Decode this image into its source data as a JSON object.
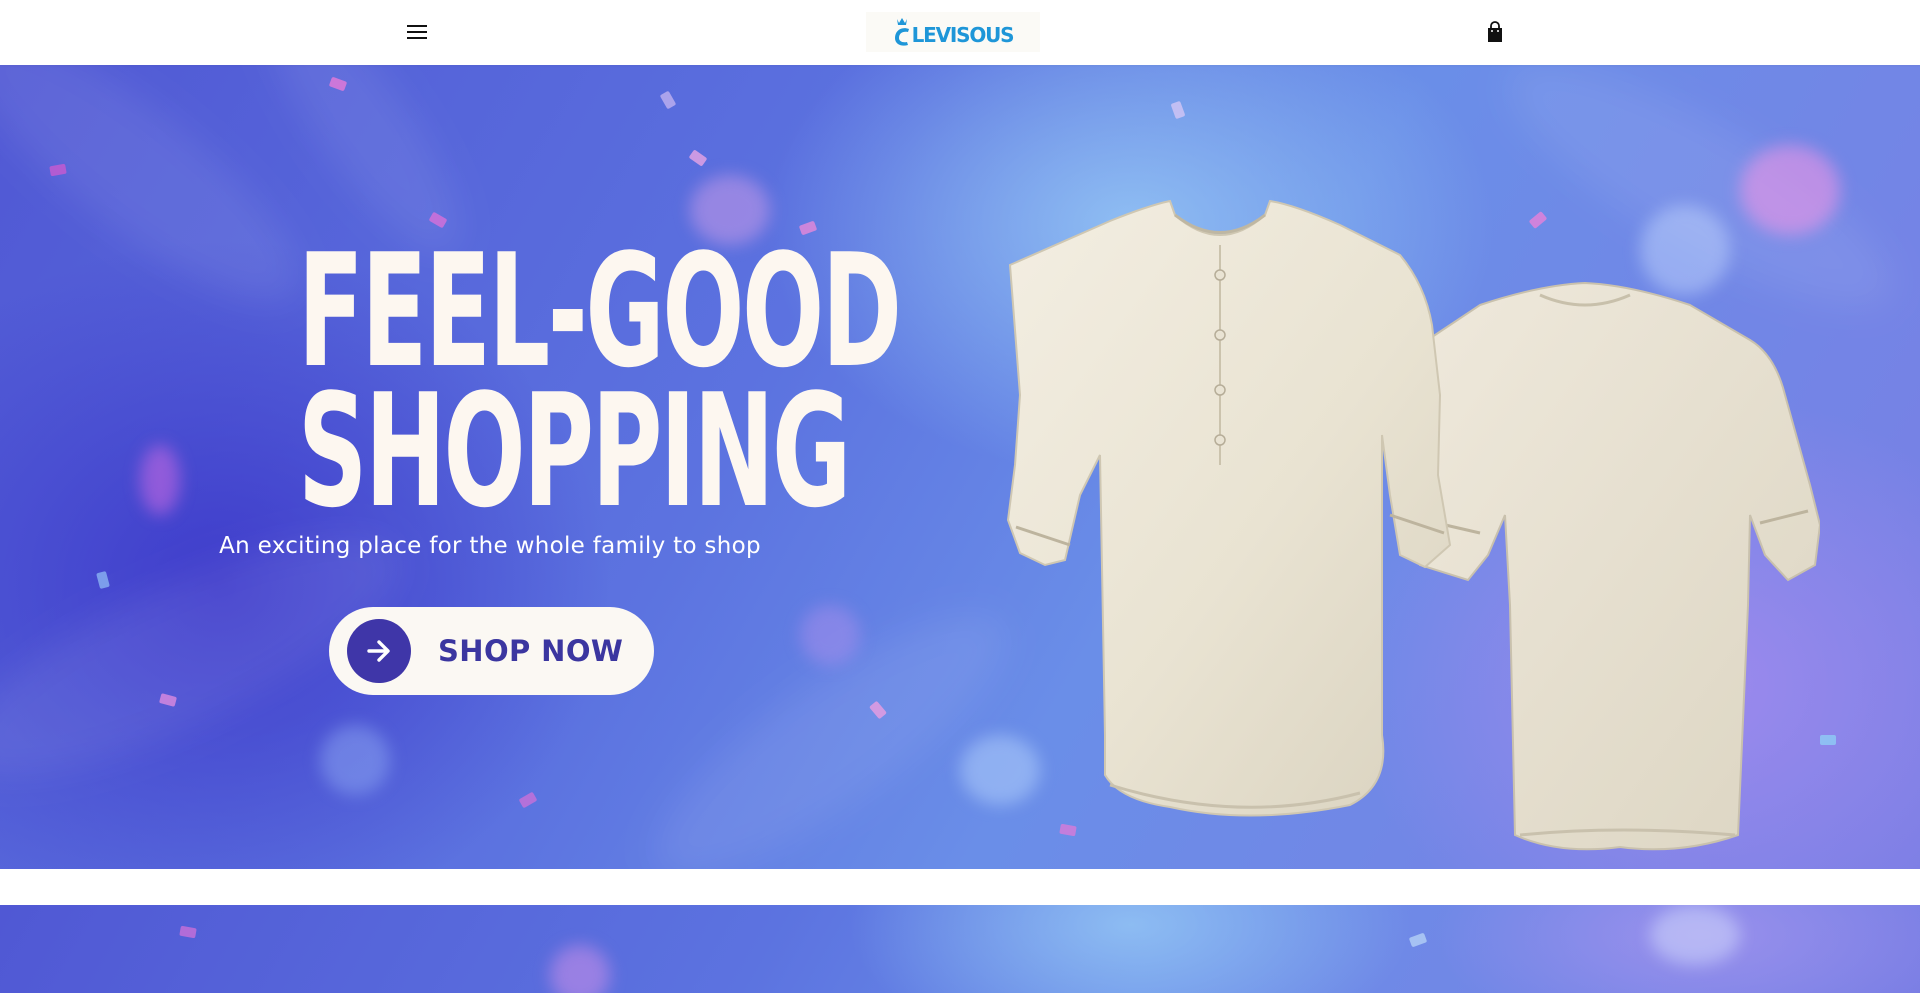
{
  "header": {
    "menu_icon": "hamburger-menu-icon",
    "logo_text": "LEVISOUS",
    "cart_icon": "shopping-bag-icon"
  },
  "hero": {
    "headline_line1": "FEEL-GOOD",
    "headline_line2": "SHOPPING",
    "subtitle": "An exciting place for the whole family to shop",
    "cta_label": "SHOP NOW",
    "cta_icon": "arrow-right-icon",
    "image_description_icon": "shirt-front-and-back-image"
  },
  "colors": {
    "brand_logo": "#1e96d8",
    "cta_accent": "#3f36a8",
    "hero_headline": "#fdf7f0",
    "cta_background": "#fbf8f3"
  }
}
